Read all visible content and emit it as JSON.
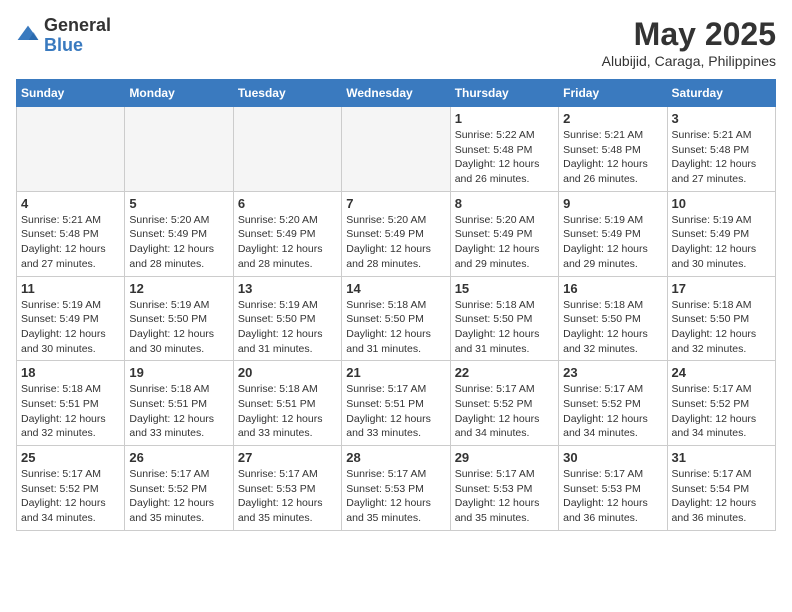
{
  "header": {
    "logo_general": "General",
    "logo_blue": "Blue",
    "month_title": "May 2025",
    "location": "Alubijid, Caraga, Philippines"
  },
  "days_of_week": [
    "Sunday",
    "Monday",
    "Tuesday",
    "Wednesday",
    "Thursday",
    "Friday",
    "Saturday"
  ],
  "weeks": [
    [
      {
        "day": "",
        "info": ""
      },
      {
        "day": "",
        "info": ""
      },
      {
        "day": "",
        "info": ""
      },
      {
        "day": "",
        "info": ""
      },
      {
        "day": "1",
        "info": "Sunrise: 5:22 AM\nSunset: 5:48 PM\nDaylight: 12 hours\nand 26 minutes."
      },
      {
        "day": "2",
        "info": "Sunrise: 5:21 AM\nSunset: 5:48 PM\nDaylight: 12 hours\nand 26 minutes."
      },
      {
        "day": "3",
        "info": "Sunrise: 5:21 AM\nSunset: 5:48 PM\nDaylight: 12 hours\nand 27 minutes."
      }
    ],
    [
      {
        "day": "4",
        "info": "Sunrise: 5:21 AM\nSunset: 5:48 PM\nDaylight: 12 hours\nand 27 minutes."
      },
      {
        "day": "5",
        "info": "Sunrise: 5:20 AM\nSunset: 5:49 PM\nDaylight: 12 hours\nand 28 minutes."
      },
      {
        "day": "6",
        "info": "Sunrise: 5:20 AM\nSunset: 5:49 PM\nDaylight: 12 hours\nand 28 minutes."
      },
      {
        "day": "7",
        "info": "Sunrise: 5:20 AM\nSunset: 5:49 PM\nDaylight: 12 hours\nand 28 minutes."
      },
      {
        "day": "8",
        "info": "Sunrise: 5:20 AM\nSunset: 5:49 PM\nDaylight: 12 hours\nand 29 minutes."
      },
      {
        "day": "9",
        "info": "Sunrise: 5:19 AM\nSunset: 5:49 PM\nDaylight: 12 hours\nand 29 minutes."
      },
      {
        "day": "10",
        "info": "Sunrise: 5:19 AM\nSunset: 5:49 PM\nDaylight: 12 hours\nand 30 minutes."
      }
    ],
    [
      {
        "day": "11",
        "info": "Sunrise: 5:19 AM\nSunset: 5:49 PM\nDaylight: 12 hours\nand 30 minutes."
      },
      {
        "day": "12",
        "info": "Sunrise: 5:19 AM\nSunset: 5:50 PM\nDaylight: 12 hours\nand 30 minutes."
      },
      {
        "day": "13",
        "info": "Sunrise: 5:19 AM\nSunset: 5:50 PM\nDaylight: 12 hours\nand 31 minutes."
      },
      {
        "day": "14",
        "info": "Sunrise: 5:18 AM\nSunset: 5:50 PM\nDaylight: 12 hours\nand 31 minutes."
      },
      {
        "day": "15",
        "info": "Sunrise: 5:18 AM\nSunset: 5:50 PM\nDaylight: 12 hours\nand 31 minutes."
      },
      {
        "day": "16",
        "info": "Sunrise: 5:18 AM\nSunset: 5:50 PM\nDaylight: 12 hours\nand 32 minutes."
      },
      {
        "day": "17",
        "info": "Sunrise: 5:18 AM\nSunset: 5:50 PM\nDaylight: 12 hours\nand 32 minutes."
      }
    ],
    [
      {
        "day": "18",
        "info": "Sunrise: 5:18 AM\nSunset: 5:51 PM\nDaylight: 12 hours\nand 32 minutes."
      },
      {
        "day": "19",
        "info": "Sunrise: 5:18 AM\nSunset: 5:51 PM\nDaylight: 12 hours\nand 33 minutes."
      },
      {
        "day": "20",
        "info": "Sunrise: 5:18 AM\nSunset: 5:51 PM\nDaylight: 12 hours\nand 33 minutes."
      },
      {
        "day": "21",
        "info": "Sunrise: 5:17 AM\nSunset: 5:51 PM\nDaylight: 12 hours\nand 33 minutes."
      },
      {
        "day": "22",
        "info": "Sunrise: 5:17 AM\nSunset: 5:52 PM\nDaylight: 12 hours\nand 34 minutes."
      },
      {
        "day": "23",
        "info": "Sunrise: 5:17 AM\nSunset: 5:52 PM\nDaylight: 12 hours\nand 34 minutes."
      },
      {
        "day": "24",
        "info": "Sunrise: 5:17 AM\nSunset: 5:52 PM\nDaylight: 12 hours\nand 34 minutes."
      }
    ],
    [
      {
        "day": "25",
        "info": "Sunrise: 5:17 AM\nSunset: 5:52 PM\nDaylight: 12 hours\nand 34 minutes."
      },
      {
        "day": "26",
        "info": "Sunrise: 5:17 AM\nSunset: 5:52 PM\nDaylight: 12 hours\nand 35 minutes."
      },
      {
        "day": "27",
        "info": "Sunrise: 5:17 AM\nSunset: 5:53 PM\nDaylight: 12 hours\nand 35 minutes."
      },
      {
        "day": "28",
        "info": "Sunrise: 5:17 AM\nSunset: 5:53 PM\nDaylight: 12 hours\nand 35 minutes."
      },
      {
        "day": "29",
        "info": "Sunrise: 5:17 AM\nSunset: 5:53 PM\nDaylight: 12 hours\nand 35 minutes."
      },
      {
        "day": "30",
        "info": "Sunrise: 5:17 AM\nSunset: 5:53 PM\nDaylight: 12 hours\nand 36 minutes."
      },
      {
        "day": "31",
        "info": "Sunrise: 5:17 AM\nSunset: 5:54 PM\nDaylight: 12 hours\nand 36 minutes."
      }
    ]
  ]
}
